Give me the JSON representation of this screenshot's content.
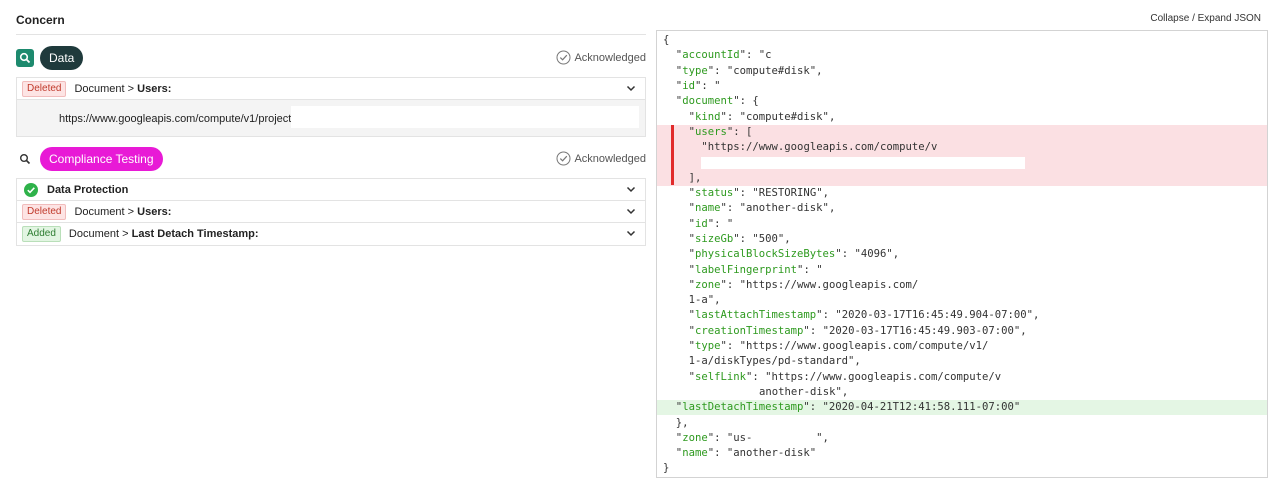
{
  "concern": {
    "title": "Concern"
  },
  "json_panel": {
    "toggle_label": "Collapse / Expand JSON",
    "lines": [
      {
        "text": "{",
        "indent": 0,
        "state": ""
      },
      {
        "key": "accountId",
        "rest": ": \"c",
        "indent": 2,
        "state": ""
      },
      {
        "key": "type",
        "rest": ": \"compute#disk\",",
        "indent": 2,
        "state": ""
      },
      {
        "key": "id",
        "rest": ": \"",
        "indent": 2,
        "state": ""
      },
      {
        "key": "document",
        "rest": ": {",
        "indent": 2,
        "state": ""
      },
      {
        "key": "kind",
        "rest": ": \"compute#disk\",",
        "indent": 4,
        "state": ""
      },
      {
        "key": "users",
        "rest": ": [",
        "indent": 4,
        "state": "del"
      },
      {
        "text": "\"https://www.googleapis.com/compute/v",
        "indent": 6,
        "state": "del"
      },
      {
        "text": "",
        "indent": 6,
        "state": "del"
      },
      {
        "text": "],",
        "indent": 4,
        "state": "del"
      },
      {
        "key": "status",
        "rest": ": \"RESTORING\",",
        "indent": 4,
        "state": ""
      },
      {
        "key": "name",
        "rest": ": \"another-disk\",",
        "indent": 4,
        "state": ""
      },
      {
        "key": "id",
        "rest": ": \"",
        "indent": 4,
        "state": ""
      },
      {
        "key": "sizeGb",
        "rest": ": \"500\",",
        "indent": 4,
        "state": ""
      },
      {
        "key": "physicalBlockSizeBytes",
        "rest": ": \"4096\",",
        "indent": 4,
        "state": ""
      },
      {
        "key": "labelFingerprint",
        "rest": ": \"",
        "indent": 4,
        "state": ""
      },
      {
        "key": "zone",
        "rest": ": \"https://www.googleapis.com/",
        "indent": 4,
        "state": ""
      },
      {
        "text": "1-a\",",
        "indent": 4,
        "state": ""
      },
      {
        "key": "lastAttachTimestamp",
        "rest": ": \"2020-03-17T16:45:49.904-07:00\",",
        "indent": 4,
        "state": ""
      },
      {
        "key": "creationTimestamp",
        "rest": ": \"2020-03-17T16:45:49.903-07:00\",",
        "indent": 4,
        "state": ""
      },
      {
        "key": "type",
        "rest": ": \"https://www.googleapis.com/compute/v1/",
        "indent": 4,
        "state": ""
      },
      {
        "text": "1-a/diskTypes/pd-standard\",",
        "indent": 4,
        "state": ""
      },
      {
        "key": "selfLink",
        "rest": ": \"https://www.googleapis.com/compute/v",
        "indent": 4,
        "state": ""
      },
      {
        "text": "another-disk\",",
        "indent": 15,
        "state": ""
      },
      {
        "key": "lastDetachTimestamp",
        "rest": ": \"2020-04-21T12:41:58.111-07:00\"",
        "indent": 2,
        "state": "add"
      },
      {
        "text": "},",
        "indent": 2,
        "state": ""
      },
      {
        "key": "zone",
        "rest": ": \"us-          \",",
        "indent": 2,
        "state": ""
      },
      {
        "key": "name",
        "rest": ": \"another-disk\"",
        "indent": 2,
        "state": ""
      },
      {
        "text": "}",
        "indent": 0,
        "state": ""
      }
    ]
  },
  "sections": [
    {
      "label": "Data",
      "acknowledged": "Acknowledged",
      "rows": [
        {
          "tag": "Deleted",
          "path": "Document > ",
          "field": "Users:"
        }
      ],
      "detail_url": "https://www.googleapis.com/compute/v1/projects/"
    },
    {
      "label": "Compliance Testing",
      "acknowledged": "Acknowledged",
      "rows": [
        {
          "tag": "",
          "path": "",
          "field": "Data Protection"
        },
        {
          "tag": "Deleted",
          "path": "Document > ",
          "field": "Users:"
        },
        {
          "tag": "Added",
          "path": "Document > ",
          "field": "Last Detach Timestamp:"
        }
      ]
    }
  ],
  "colors": {
    "accent_teal": "#1d8a6e",
    "pill_dark": "#1f3a3c",
    "pill_magenta": "#e81ad6",
    "json_key": "#2e9a1f",
    "deleted_bg": "#fbe0e3",
    "added_bg": "#e4f6e4"
  }
}
